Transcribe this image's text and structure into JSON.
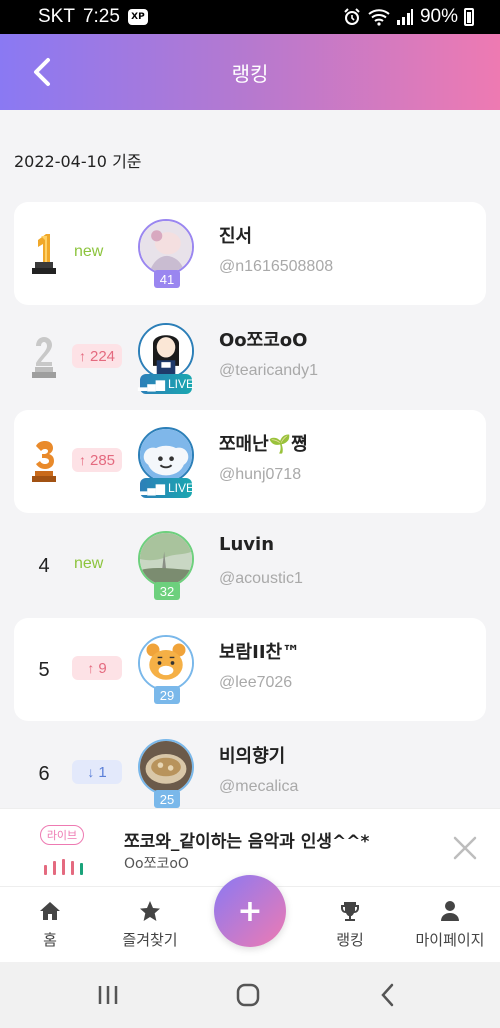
{
  "status_bar": {
    "carrier": "SKT",
    "time": "7:25",
    "app_badge": "XP",
    "battery": "90%"
  },
  "header": {
    "title": "랭킹"
  },
  "date_label": "2022-04-10 기준",
  "rankings": [
    {
      "rank": "1",
      "change": "new",
      "change_type": "new",
      "name": "진서",
      "handle": "@n1616508808",
      "level": "41",
      "level_color": "#9a86f0",
      "live": false
    },
    {
      "rank": "2",
      "change": "224",
      "change_type": "up",
      "name": "Oo쪼코oO",
      "handle": "@tearicandy1",
      "live": true,
      "live_label": "LIVE"
    },
    {
      "rank": "3",
      "change": "285",
      "change_type": "up",
      "name": "쪼매난🌱쪙",
      "handle": "@hunj0718",
      "live": true,
      "live_label": "LIVE"
    },
    {
      "rank": "4",
      "change": "new",
      "change_type": "new",
      "name": "Luvin",
      "handle": "@acoustic1",
      "level": "32",
      "level_color": "#6dd07d",
      "live": false
    },
    {
      "rank": "5",
      "change": "9",
      "change_type": "up",
      "name": "보람II찬™",
      "handle": "@lee7026",
      "level": "29",
      "level_color": "#7ab8ea",
      "live": false
    },
    {
      "rank": "6",
      "change": "1",
      "change_type": "down",
      "name": "비의향기",
      "handle": "@mecalica",
      "level": "25",
      "level_color": "#7ab8ea",
      "live": false
    }
  ],
  "mini_player": {
    "badge": "라이브",
    "title": "쪼코와_같이하는 음악과 인생^^*",
    "host": "Oo쪼코oO"
  },
  "bottom_nav": {
    "home": "홈",
    "favorites": "즐겨찾기",
    "add": "+",
    "ranking": "랭킹",
    "mypage": "마이페이지"
  },
  "colors": {
    "header_start": "#8a79f3",
    "header_end": "#ee7ab2",
    "up": "#e46a7f",
    "down": "#5b7fd8",
    "new": "#8cc43d"
  }
}
